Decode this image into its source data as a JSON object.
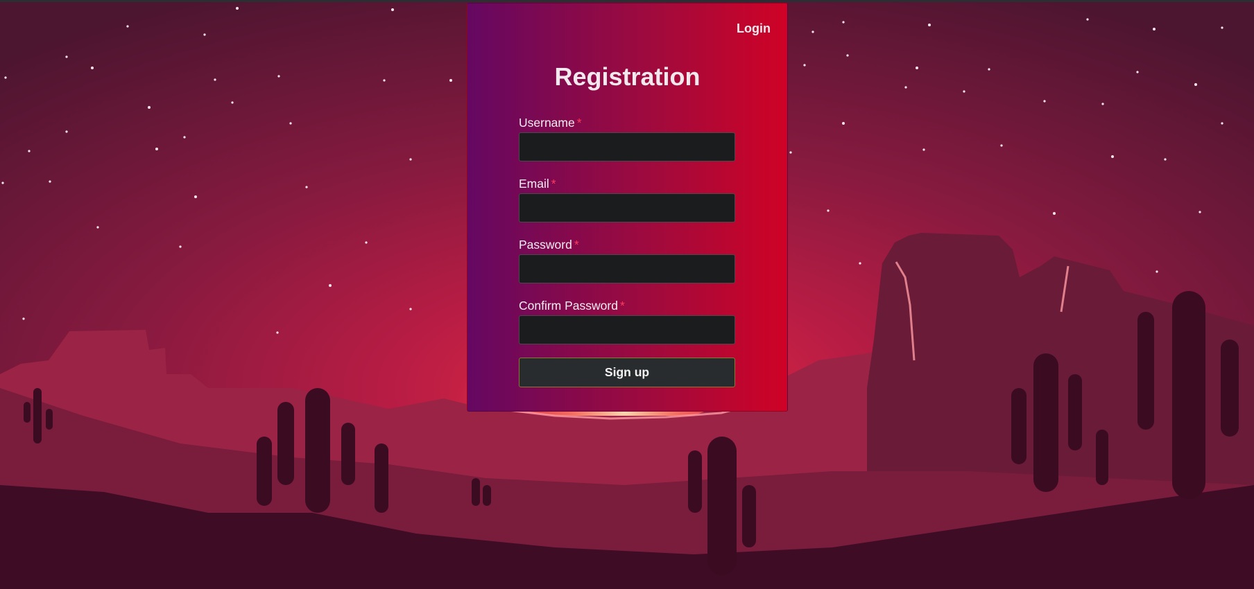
{
  "header": {
    "login_label": "Login"
  },
  "form": {
    "title": "Registration",
    "required_marker": "*",
    "fields": [
      {
        "label": "Username",
        "value": "",
        "type": "text"
      },
      {
        "label": "Email",
        "value": "",
        "type": "email"
      },
      {
        "label": "Password",
        "value": "",
        "type": "password"
      },
      {
        "label": "Confirm Password",
        "value": "",
        "type": "password"
      }
    ],
    "submit_label": "Sign up"
  },
  "colors": {
    "card_gradient_start": "#650862",
    "card_gradient_end": "#cf0226",
    "required": "#ff3b5c",
    "input_background": "#1b1c1e",
    "button_background": "#292c2f",
    "sky_glow": "#c8183f",
    "cactus": "#3a0a22"
  }
}
